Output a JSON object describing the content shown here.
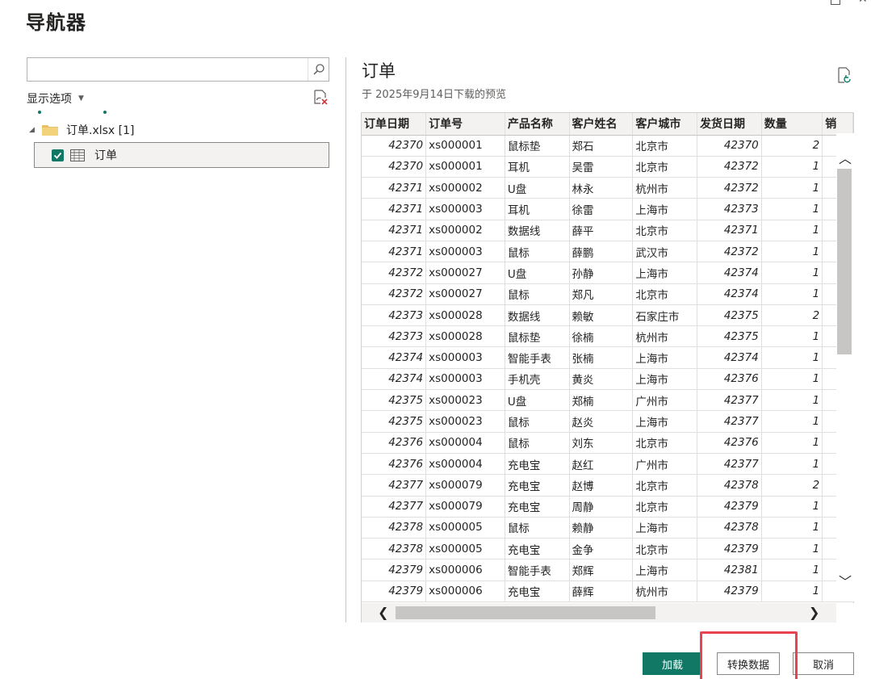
{
  "window": {
    "title": "导航器"
  },
  "search": {
    "placeholder": "",
    "value": ""
  },
  "left_panel": {
    "display_options_label": "显示选项",
    "tree": {
      "file_label": "订单.xlsx [1]",
      "table_label": "订单",
      "table_checked": true
    }
  },
  "preview": {
    "title": "订单",
    "subtitle": "于 2025年9月14日下载的预览",
    "columns": [
      "订单日期",
      "订单号",
      "产品名称",
      "客户姓名",
      "客户城市",
      "发货日期",
      "数量",
      "销"
    ],
    "rows": [
      [
        "42370",
        "xs000001",
        "鼠标垫",
        "郑石",
        "北京市",
        "42370",
        "2"
      ],
      [
        "42370",
        "xs000001",
        "耳机",
        "吴雷",
        "北京市",
        "42372",
        "1"
      ],
      [
        "42371",
        "xs000002",
        "U盘",
        "林永",
        "杭州市",
        "42372",
        "1"
      ],
      [
        "42371",
        "xs000003",
        "耳机",
        "徐雷",
        "上海市",
        "42373",
        "1"
      ],
      [
        "42371",
        "xs000002",
        "数据线",
        "薛平",
        "北京市",
        "42371",
        "1"
      ],
      [
        "42371",
        "xs000003",
        "鼠标",
        "薛鹏",
        "武汉市",
        "42372",
        "1"
      ],
      [
        "42372",
        "xs000027",
        "U盘",
        "孙静",
        "上海市",
        "42374",
        "1"
      ],
      [
        "42372",
        "xs000027",
        "鼠标",
        "郑凡",
        "北京市",
        "42374",
        "1"
      ],
      [
        "42373",
        "xs000028",
        "数据线",
        "赖敏",
        "石家庄市",
        "42375",
        "2"
      ],
      [
        "42373",
        "xs000028",
        "鼠标垫",
        "徐楠",
        "杭州市",
        "42375",
        "1"
      ],
      [
        "42374",
        "xs000003",
        "智能手表",
        "张楠",
        "上海市",
        "42374",
        "1"
      ],
      [
        "42374",
        "xs000003",
        "手机壳",
        "黄炎",
        "上海市",
        "42376",
        "1"
      ],
      [
        "42375",
        "xs000023",
        "U盘",
        "郑楠",
        "广州市",
        "42377",
        "1"
      ],
      [
        "42375",
        "xs000023",
        "鼠标",
        "赵炎",
        "上海市",
        "42377",
        "1"
      ],
      [
        "42376",
        "xs000004",
        "鼠标",
        "刘东",
        "北京市",
        "42376",
        "1"
      ],
      [
        "42376",
        "xs000004",
        "充电宝",
        "赵红",
        "广州市",
        "42377",
        "1"
      ],
      [
        "42377",
        "xs000079",
        "充电宝",
        "赵博",
        "北京市",
        "42378",
        "2"
      ],
      [
        "42377",
        "xs000079",
        "充电宝",
        "周静",
        "北京市",
        "42379",
        "1"
      ],
      [
        "42378",
        "xs000005",
        "鼠标",
        "赖静",
        "上海市",
        "42378",
        "1"
      ],
      [
        "42378",
        "xs000005",
        "充电宝",
        "金争",
        "北京市",
        "42379",
        "1"
      ],
      [
        "42379",
        "xs000006",
        "智能手表",
        "郑辉",
        "上海市",
        "42381",
        "1"
      ],
      [
        "42379",
        "xs000006",
        "充电宝",
        "薛辉",
        "杭州市",
        "42379",
        "1"
      ]
    ]
  },
  "buttons": {
    "load": "加载",
    "transform": "转换数据",
    "cancel": "取消"
  },
  "colors": {
    "accent": "#117865",
    "highlight": "#e8434e"
  },
  "icons": {
    "search": "search-icon",
    "refresh_left": "refresh-icon",
    "refresh_right": "refresh-icon",
    "folder": "folder-icon",
    "table": "table-icon"
  }
}
